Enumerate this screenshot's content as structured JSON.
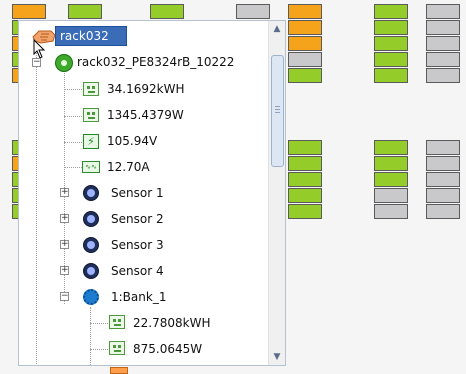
{
  "tree": {
    "root": {
      "label": "rack032"
    },
    "device": {
      "label": "rack032_PE8324rB_10222"
    },
    "readings": [
      {
        "icon": "meter",
        "label": "34.1692kWH"
      },
      {
        "icon": "meter",
        "label": "1345.4379W"
      },
      {
        "icon": "voltage",
        "label": "105.94V"
      },
      {
        "icon": "current",
        "label": "12.70A"
      }
    ],
    "sensors": [
      {
        "label": "Sensor 1"
      },
      {
        "label": "Sensor 2"
      },
      {
        "label": "Sensor 3"
      },
      {
        "label": "Sensor 4"
      }
    ],
    "bank": {
      "label": "1:Bank_1"
    },
    "bank_readings": [
      {
        "icon": "meter",
        "label": "22.7808kWH"
      },
      {
        "icon": "meter",
        "label": "875.0645W"
      }
    ],
    "icons": {
      "root": "hand-icon",
      "device": "device-icon",
      "meter": "meter-icon",
      "voltage": "lightning-icon",
      "current": "current-icon",
      "sensor": "sensor-icon",
      "bank": "gear-icon"
    },
    "expander_plus": "+",
    "expander_minus": "−"
  },
  "colors": {
    "green": "#94cc2a",
    "orange": "#f5a31a",
    "gray": "#c9c9cb",
    "selection": "#3a6cb8"
  }
}
